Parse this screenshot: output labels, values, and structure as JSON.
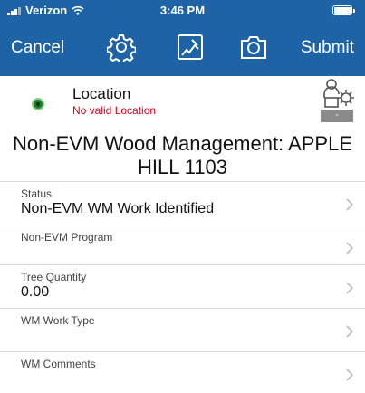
{
  "status_bar": {
    "carrier": "Verizon",
    "time": "3:46 PM"
  },
  "nav": {
    "cancel_label": "Cancel",
    "submit_label": "Submit",
    "icons": [
      "gear-icon",
      "map-edit-icon",
      "camera-icon"
    ],
    "background": "#1d63a6"
  },
  "location": {
    "title": "Location",
    "status": "No valid Location",
    "status_color": "#d0021b",
    "badge": "-"
  },
  "page_title": "Non-EVM Wood Management: APPLE HILL 1103",
  "fields": [
    {
      "label": "Status",
      "value": "Non-EVM WM Work Identified"
    },
    {
      "label": "Non-EVM Program",
      "value": ""
    },
    {
      "label": "Tree Quantity",
      "value": "0.00"
    },
    {
      "label": "WM Work Type",
      "value": ""
    },
    {
      "label": "WM Comments",
      "value": ""
    }
  ]
}
